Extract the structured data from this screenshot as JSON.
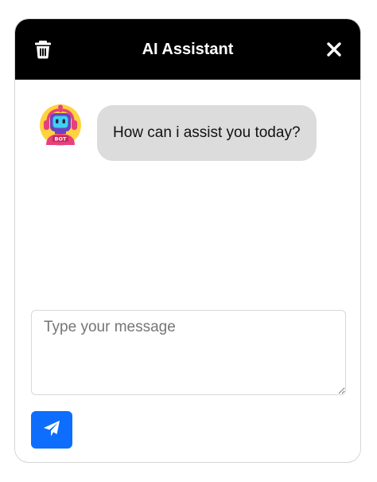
{
  "header": {
    "title": "AI Assistant",
    "trash_icon": "trash-icon",
    "close_icon": "close-icon"
  },
  "messages": [
    {
      "sender": "bot",
      "avatar_icon": "robot-avatar-icon",
      "avatar_badge": "BOT",
      "text": "How can i assist you today?"
    }
  ],
  "composer": {
    "value": "",
    "placeholder": "Type your message",
    "send_icon": "paper-plane-icon"
  },
  "colors": {
    "header_bg": "#000000",
    "header_text": "#ffffff",
    "bubble_bg": "#dcdcdc",
    "send_button": "#0d6efd"
  }
}
